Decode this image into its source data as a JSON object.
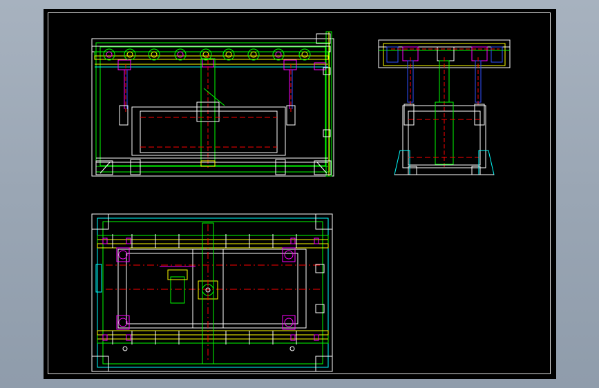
{
  "colors": {
    "background": "#9aa6b4",
    "sheet": "#000000",
    "border": "#e6e6e6",
    "white": "#ffffff",
    "green": "#00ff00",
    "yellow": "#ffff00",
    "magenta": "#ff00ff",
    "red": "#ff0000",
    "cyan": "#00ffff",
    "blue": "#3050ff"
  },
  "views": [
    {
      "name": "front-view"
    },
    {
      "name": "side-view"
    },
    {
      "name": "top-view"
    }
  ]
}
